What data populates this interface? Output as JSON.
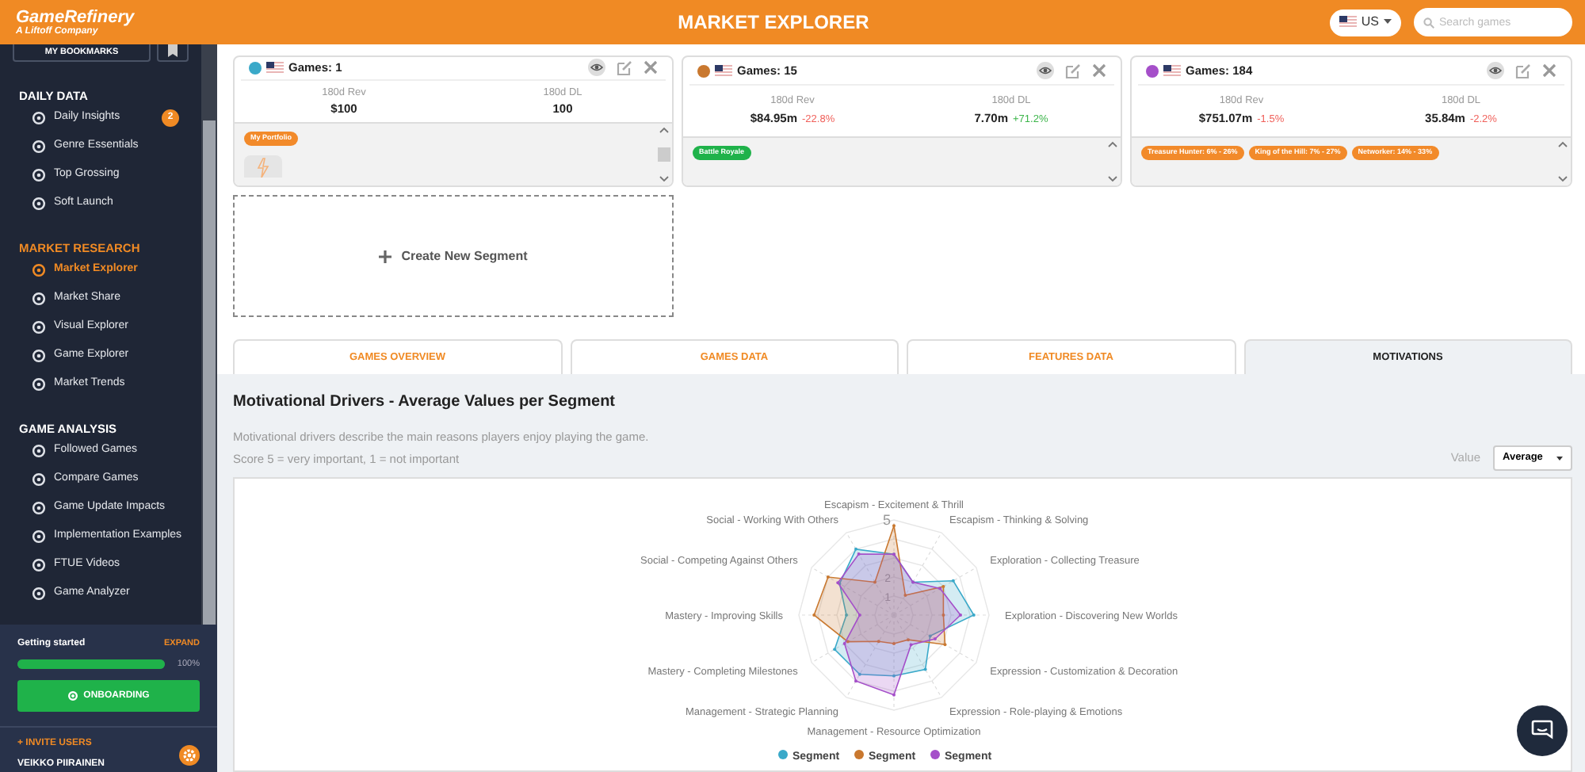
{
  "header": {
    "logo_title": "GameRefinery",
    "logo_subtitle": "A Liftoff Company",
    "title": "MARKET EXPLORER",
    "country": "US",
    "search_placeholder": "Search games"
  },
  "sidebar": {
    "bookmarks": "MY BOOKMARKS",
    "sections": [
      {
        "title": "DAILY DATA",
        "items": [
          {
            "label": "Daily Insights",
            "selected": false,
            "badge": "2"
          },
          {
            "label": "Genre Essentials",
            "selected": false
          },
          {
            "label": "Top Grossing",
            "selected": false
          },
          {
            "label": "Soft Launch",
            "selected": false
          }
        ]
      },
      {
        "title": "MARKET RESEARCH",
        "items": [
          {
            "label": "Market Explorer",
            "selected": true
          },
          {
            "label": "Market Share",
            "selected": false
          },
          {
            "label": "Visual Explorer",
            "selected": false
          },
          {
            "label": "Game Explorer",
            "selected": false
          },
          {
            "label": "Market Trends",
            "selected": false
          }
        ]
      },
      {
        "title": "GAME ANALYSIS",
        "items": [
          {
            "label": "Followed Games",
            "selected": false
          },
          {
            "label": "Compare Games",
            "selected": false
          },
          {
            "label": "Game Update Impacts",
            "selected": false
          },
          {
            "label": "Implementation Examples",
            "selected": false
          },
          {
            "label": "FTUE Videos",
            "selected": false
          },
          {
            "label": "Game Analyzer",
            "selected": false
          }
        ]
      }
    ]
  },
  "onboarding": {
    "label": "Getting started",
    "expand": "EXPAND",
    "level": 1,
    "reading": "100%",
    "button": "ONBOARDING",
    "invite": "+ INVITE USERS",
    "user": "VEIKKO PIIRAINEN"
  },
  "segments": [
    {
      "color": "#3aa9c9",
      "title": "Games: 1",
      "stats": [
        {
          "label": "180d Rev",
          "value": "$100"
        },
        {
          "label": "180d DL",
          "value": "100"
        }
      ],
      "tags": [
        {
          "label": "My Portfolio",
          "color": "#f28a2a"
        }
      ],
      "games": [
        {
          "kind": "picture"
        }
      ],
      "scrollbar": true
    },
    {
      "color": "#c9782f",
      "title": "Games: 15",
      "stats": [
        {
          "label": "180d Rev",
          "value": "$84.95m",
          "change": "-22.8%",
          "positive": false
        },
        {
          "label": "180d DL",
          "value": "7.70m",
          "change": "+71.2%",
          "positive": true
        }
      ],
      "tags": [
        {
          "label": "Battle Royale",
          "color": "#1fb24a"
        }
      ],
      "scrollbar": false
    },
    {
      "color": "#a54fc9",
      "title": "Games: 184",
      "stats": [
        {
          "label": "180d Rev",
          "value": "$751.07m",
          "change": "-1.5%",
          "positive": false
        },
        {
          "label": "180d DL",
          "value": "35.84m",
          "change": "-2.2%",
          "positive": false
        }
      ],
      "tags": [
        {
          "label": "Treasure Hunter: 6% - 26%",
          "color": "#f28a2a"
        },
        {
          "label": "King of the Hill: 7% - 27%",
          "color": "#f28a2a"
        },
        {
          "label": "Networker: 14% - 33%",
          "color": "#f28a2a"
        }
      ],
      "scrollbar": false
    }
  ],
  "create_segment": "Create New Segment",
  "tabs": [
    {
      "label": "GAMES OVERVIEW",
      "selected": false
    },
    {
      "label": "GAMES DATA",
      "selected": false
    },
    {
      "label": "FEATURES DATA",
      "selected": false
    },
    {
      "label": "MOTIVATIONS",
      "selected": true
    }
  ],
  "motivations": {
    "title": "Motivational Drivers - Average Values per Segment",
    "description": [
      "Motivational drivers describe the main reasons players enjoy playing the game.",
      "Score 5 = very important, 1 = not important"
    ],
    "value_label": "Value",
    "value_select": "Average",
    "radar": {
      "axes": [
        "Escapism - Excitement & Thrill",
        "Social - Working With Others",
        "Escapism - Thinking & Solving",
        "Social - Competing Against Others",
        "Exploration - Collecting Treasure",
        "Mastery - Improving Skills",
        "Exploration - Discovering New Worlds",
        "Mastery - Completing Milestones",
        "Expression - Customization & Decoration",
        "Management - Strategic Planning",
        "Expression - Role-playing & Emotions",
        "Management - Resource Optimization"
      ],
      "scale_labels": [
        "5",
        "2",
        "1"
      ],
      "series": [
        {
          "name": "Segment",
          "color": "#3aa9c9"
        },
        {
          "name": "Segment",
          "color": "#c9782f"
        },
        {
          "name": "Segment",
          "color": "#a54fc9"
        }
      ]
    }
  }
}
